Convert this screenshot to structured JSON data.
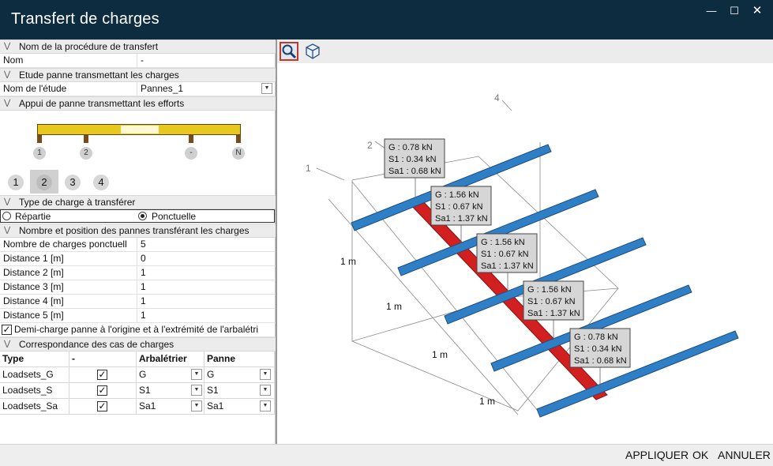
{
  "window": {
    "title": "Transfert de charges",
    "min_icon": "minimize-icon",
    "max_icon": "maximize-icon",
    "close_icon": "close-icon"
  },
  "sections": {
    "proc": "Nom de la procédure de transfert",
    "etude": "Etude panne transmettant les charges",
    "appui": "Appui de panne transmettant les efforts",
    "type": "Type de charge à transférer",
    "nombre": "Nombre et position des pannes transférant les charges",
    "corr": "Correspondance des cas de charges"
  },
  "proc": {
    "label": "Nom",
    "value": "-"
  },
  "etude": {
    "label": "Nom de l'étude",
    "value": "Pannes_1"
  },
  "appui": {
    "markers": [
      "1",
      "2",
      "-",
      "N"
    ],
    "tabs": [
      "1",
      "2",
      "3",
      "4"
    ],
    "selected_tab": "2"
  },
  "type": {
    "options": [
      "Répartie",
      "Ponctuelle"
    ],
    "selected": "Ponctuelle"
  },
  "nombre": {
    "rows": [
      {
        "label": "Nombre  de  charges ponctuell",
        "value": "5"
      },
      {
        "label": "Distance 1   [m]",
        "value": "0"
      },
      {
        "label": "Distance 2   [m]",
        "value": "1"
      },
      {
        "label": "Distance 3   [m]",
        "value": "1"
      },
      {
        "label": "Distance 4   [m]",
        "value": "1"
      },
      {
        "label": "Distance 5   [m]",
        "value": "1"
      }
    ],
    "demi_charge": "Demi-charge panne à l'origine et à l'extrémité de l'arbalétri"
  },
  "corr": {
    "headers": [
      "Type",
      "-",
      "Arbalétrier",
      "Panne"
    ],
    "rows": [
      {
        "type": "Loadsets_G",
        "checked": true,
        "arb": "G",
        "panne": "G"
      },
      {
        "type": "Loadsets_S",
        "checked": true,
        "arb": "S1",
        "panne": "S1"
      },
      {
        "type": "Loadsets_Sa",
        "checked": true,
        "arb": "Sa1",
        "panne": "Sa1"
      }
    ]
  },
  "toolbar": {
    "zoom_icon": "zoom-icon",
    "view3d_icon": "view-3d-icon"
  },
  "viewer": {
    "axis_labels": [
      "1",
      "2",
      "4"
    ],
    "dims": [
      "1 m",
      "1 m",
      "1 m",
      "1 m"
    ],
    "tooltips": [
      {
        "g": "G : 0.78 kN",
        "s": "S1 : 0.34 kN",
        "sa": "Sa1 : 0.68 kN"
      },
      {
        "g": "G : 1.56 kN",
        "s": "S1 : 0.67 kN",
        "sa": "Sa1 : 1.37 kN"
      },
      {
        "g": "G : 1.56 kN",
        "s": "S1 : 0.67 kN",
        "sa": "Sa1 : 1.37 kN"
      },
      {
        "g": "G : 1.56 kN",
        "s": "S1 : 0.67 kN",
        "sa": "Sa1 : 1.37 kN"
      },
      {
        "g": "G : 0.78 kN",
        "s": "S1 : 0.34 kN",
        "sa": "Sa1 : 0.68 kN"
      }
    ],
    "colors": {
      "panne": "#2f7fc6",
      "arbaletrier": "#d22020"
    }
  },
  "buttons": {
    "apply": "APPLIQUER",
    "ok": "OK",
    "cancel": "ANNULER"
  }
}
